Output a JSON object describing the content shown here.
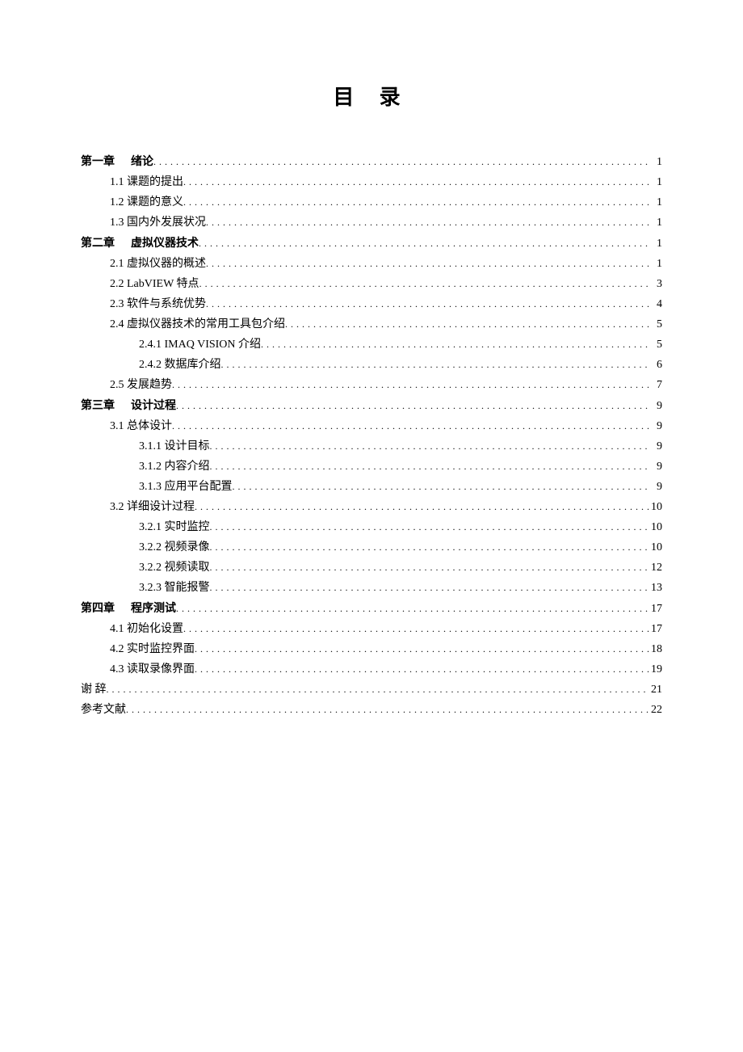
{
  "title": "目 录",
  "entries": [
    {
      "level": 0,
      "prefix": "第一章",
      "label": "绪论",
      "page": "1",
      "chapter": true
    },
    {
      "level": 1,
      "prefix": "1.1",
      "label": "课题的提出",
      "page": "1"
    },
    {
      "level": 1,
      "prefix": "1.2",
      "label": "课题的意义",
      "page": "1"
    },
    {
      "level": 1,
      "prefix": "1.3",
      "label": "国内外发展状况",
      "page": "1"
    },
    {
      "level": 0,
      "prefix": "第二章",
      "label": "虚拟仪器技术",
      "page": "1",
      "chapter": true
    },
    {
      "level": 1,
      "prefix": "2.1",
      "label": "虚拟仪器的概述",
      "page": "1"
    },
    {
      "level": 1,
      "prefix": "2.2",
      "label": "LabVIEW 特点",
      "page": "3"
    },
    {
      "level": 1,
      "prefix": "2.3",
      "label": "软件与系统优势",
      "page": "4"
    },
    {
      "level": 1,
      "prefix": "2.4",
      "label": "虚拟仪器技术的常用工具包介绍",
      "page": "5"
    },
    {
      "level": 2,
      "prefix": "2.4.1",
      "label": "IMAQ VISION 介绍",
      "page": "5"
    },
    {
      "level": 2,
      "prefix": "2.4.2",
      "label": "数据库介绍",
      "page": "6"
    },
    {
      "level": 1,
      "prefix": "2.5",
      "label": "发展趋势",
      "page": "7"
    },
    {
      "level": 0,
      "prefix": "第三章",
      "label": "设计过程",
      "page": "9",
      "chapter": true
    },
    {
      "level": 1,
      "prefix": "3.1",
      "label": "总体设计",
      "page": "9"
    },
    {
      "level": 2,
      "prefix": "3.1.1",
      "label": "设计目标",
      "page": "9"
    },
    {
      "level": 2,
      "prefix": "3.1.2",
      "label": "内容介绍",
      "page": "9"
    },
    {
      "level": 2,
      "prefix": "3.1.3",
      "label": "应用平台配置",
      "page": "9"
    },
    {
      "level": 1,
      "prefix": "3.2",
      "label": "详细设计过程",
      "page": "10"
    },
    {
      "level": 2,
      "prefix": "3.2.1",
      "label": "实时监控",
      "page": "10"
    },
    {
      "level": 2,
      "prefix": "3.2.2",
      "label": "视频录像",
      "page": "10"
    },
    {
      "level": 2,
      "prefix": "3.2.2",
      "label": "视频读取",
      "page": "12"
    },
    {
      "level": 2,
      "prefix": "3.2.3",
      "label": "智能报警",
      "page": "13"
    },
    {
      "level": 0,
      "prefix": "第四章",
      "label": "程序测试",
      "page": "17",
      "chapter": true
    },
    {
      "level": 1,
      "prefix": "4.1",
      "label": "初始化设置",
      "page": "17"
    },
    {
      "level": 1,
      "prefix": "4.2",
      "label": "实时监控界面",
      "page": "18"
    },
    {
      "level": 1,
      "prefix": "4.3",
      "label": "读取录像界面",
      "page": "19"
    },
    {
      "level": 0,
      "prefix": "谢  辞",
      "label": "",
      "page": "21",
      "plain": true
    },
    {
      "level": 0,
      "prefix": "参考文献",
      "label": "",
      "page": "22",
      "plain": true
    }
  ]
}
